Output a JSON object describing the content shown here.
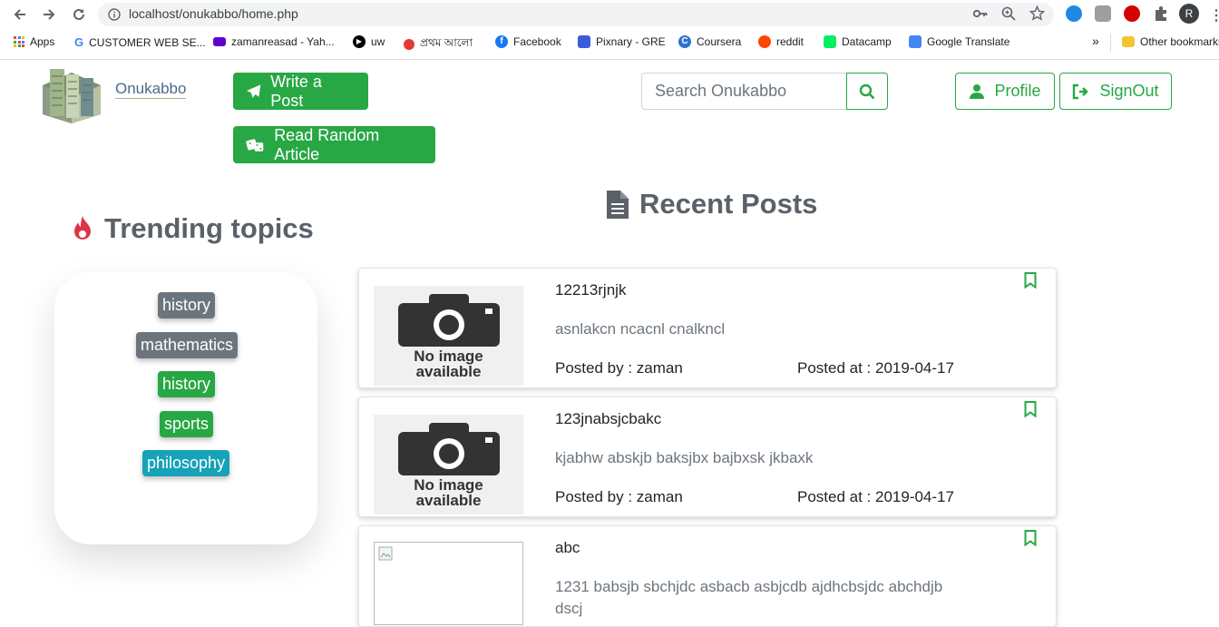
{
  "browser": {
    "url": "localhost/onukabbo/home.php",
    "bookmarks": [
      {
        "label": "Apps",
        "color": "#e8453c"
      },
      {
        "label": "CUSTOMER WEB SE...",
        "color": "#4285f4"
      },
      {
        "label": "zamanreasad - Yah...",
        "color": "#6001d2"
      },
      {
        "label": "uw",
        "color": "#000000"
      },
      {
        "label": "প্রথম আলো",
        "color": "#e53935"
      },
      {
        "label": "Facebook",
        "color": "#1877f2"
      },
      {
        "label": "Pixnary - GRE",
        "color": "#3b5bdb"
      },
      {
        "label": "Coursera",
        "color": "#2a73cc"
      },
      {
        "label": "reddit",
        "color": "#ff4500"
      },
      {
        "label": "Datacamp",
        "color": "#03ef62"
      },
      {
        "label": "Google Translate",
        "color": "#4285f4"
      }
    ],
    "more": "»",
    "other_bookmarks": "Other bookmarks",
    "profile_initial": "R"
  },
  "site": {
    "logo_text": "Onukabbo",
    "write_post": "Write a Post",
    "random_article": "Read Random Article",
    "search_placeholder": "Search Onukabbo",
    "profile": "Profile",
    "signout": "SignOut"
  },
  "trending": {
    "title": "Trending topics",
    "tags": [
      {
        "label": "history",
        "color": "#6c757d"
      },
      {
        "label": "mathematics",
        "color": "#6c757d"
      },
      {
        "label": "history",
        "color": "#28a745"
      },
      {
        "label": "sports",
        "color": "#28a745"
      },
      {
        "label": "philosophy",
        "color": "#17a2b8"
      }
    ]
  },
  "recent": {
    "title": "Recent Posts",
    "no_image_line1": "No image",
    "no_image_line2": "available",
    "posts": [
      {
        "title": "12213rjnjk",
        "desc": "asnlakcn ncacnl cnalkncl",
        "author": "Posted by : zaman",
        "date": "Posted at : 2019-04-17"
      },
      {
        "title": "123jnabsjcbakc",
        "desc": "kjabhw abskjb baksjbx bajbxsk jkbaxk",
        "author": "Posted by : zaman",
        "date": "Posted at : 2019-04-17"
      },
      {
        "title": "abc",
        "desc": "1231 babsjb sbchjdc asbacb asbjcdb ajdhcbsjdc abchdjb",
        "desc2": "dscj"
      }
    ]
  }
}
